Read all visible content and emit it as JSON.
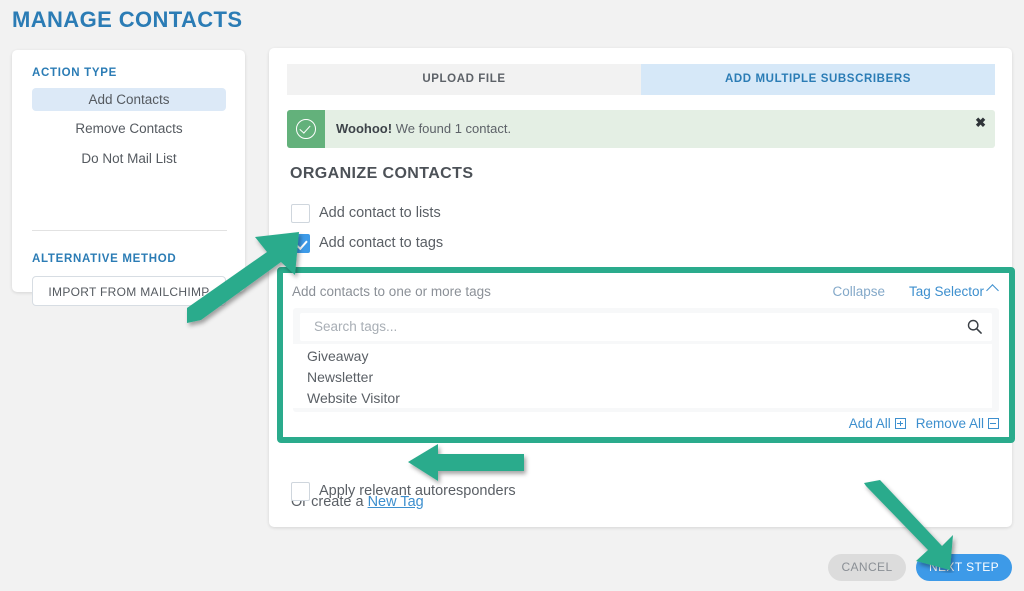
{
  "page": {
    "title": "MANAGE CONTACTS"
  },
  "sidebar": {
    "action_heading": "ACTION TYPE",
    "items": [
      {
        "label": "Add Contacts",
        "selected": true
      },
      {
        "label": "Remove Contacts",
        "selected": false
      },
      {
        "label": "Do Not Mail List",
        "selected": false
      }
    ],
    "alt_heading": "ALTERNATIVE METHOD",
    "mailchimp_button": "IMPORT FROM MAILCHIMP"
  },
  "main": {
    "tabs": [
      {
        "label": "UPLOAD FILE",
        "active": false
      },
      {
        "label": "ADD MULTIPLE SUBSCRIBERS",
        "active": true
      }
    ],
    "alert": {
      "strong": "Woohoo!",
      "message": " We found 1 contact.",
      "close_label": "✖",
      "icon": "check-circle-icon",
      "bg_color": "#e4efe4",
      "accent_color": "#63b17b"
    },
    "organize_heading": "ORGANIZE CONTACTS",
    "checkboxes": [
      {
        "label": "Add contact to lists",
        "checked": false
      },
      {
        "label": "Add contact to tags",
        "checked": true
      }
    ],
    "tag_selector": {
      "title": "Add contacts to one or more tags",
      "collapse_label": "Collapse",
      "selector_label": "Tag Selector",
      "search_placeholder": "Search tags...",
      "tags": [
        "Giveaway",
        "Newsletter",
        "Website Visitor"
      ],
      "add_all_label": "Add All",
      "remove_all_label": "Remove All",
      "highlight_color": "#2aab8c"
    },
    "new_tag": {
      "prefix": "Or create a ",
      "link_label": "New Tag"
    },
    "autoresponders": {
      "label": "Apply relevant autoresponders",
      "checked": false
    }
  },
  "footer": {
    "cancel_label": "CANCEL",
    "next_label": "NEXT STEP",
    "next_color": "#3d9ae8"
  },
  "annotations": {
    "arrow_color": "#2aab8c",
    "arrows": [
      {
        "name": "arrow-to-add-contact-to-tags"
      },
      {
        "name": "arrow-to-new-tag"
      },
      {
        "name": "arrow-to-next-step"
      }
    ]
  }
}
